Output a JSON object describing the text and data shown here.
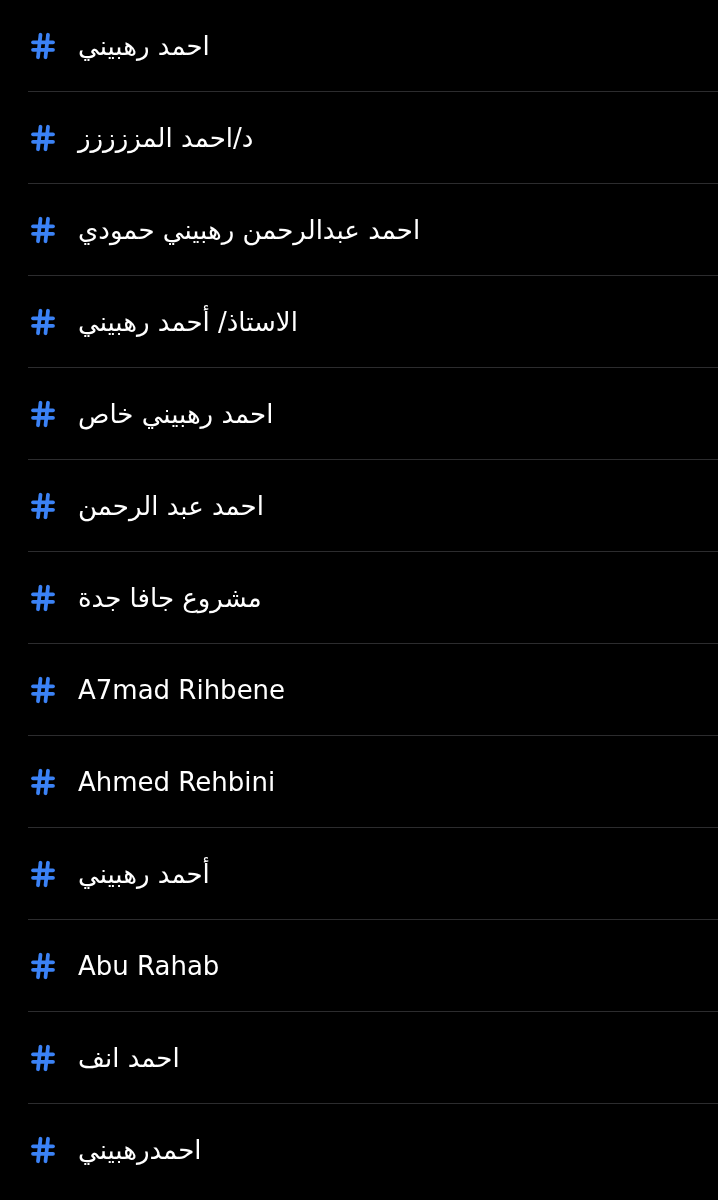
{
  "hashtags": [
    {
      "label": "احمد رهبيني"
    },
    {
      "label": "د/احمد المززززز"
    },
    {
      "label": "احمد عبدالرحمن رهبيني حمودي"
    },
    {
      "label": "الاستاذ/ أحمد رهبيني"
    },
    {
      "label": "احمد رهبيني خاص"
    },
    {
      "label": "احمد عبد الرحمن"
    },
    {
      "label": "مشروع جافا جدة"
    },
    {
      "label": "A7mad Rihbene"
    },
    {
      "label": "Ahmed Rehbini"
    },
    {
      "label": "أحمد رهبيني"
    },
    {
      "label": "Abu Rahab"
    },
    {
      "label": "احمد انف"
    },
    {
      "label": "احمدرهبيني"
    }
  ]
}
